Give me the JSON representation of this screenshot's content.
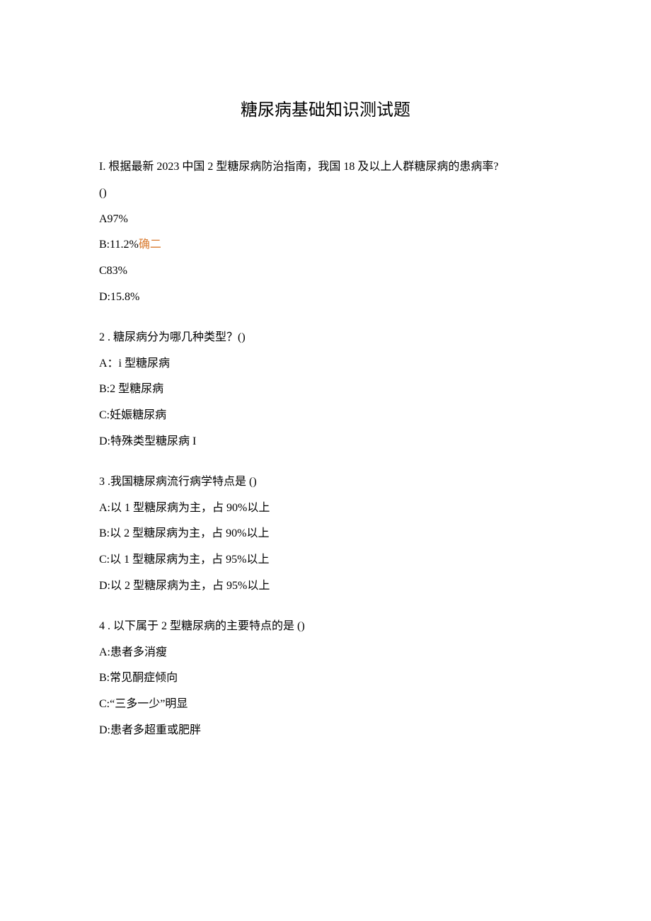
{
  "title": "糖尿病基础知识测试题",
  "q1": {
    "stem_a": "I. 根据最新 2023 中国 2 型糖尿病防治指南，我国 18 及以上人群糖尿病的患病率?",
    "stem_b": "()",
    "a": "A97%",
    "b_pre": "B:11.2%",
    "b_mark": "确二",
    "c": "C83%",
    "d": "D:15.8%"
  },
  "q2": {
    "stem": "2  . 糖尿病分为哪几种类型？()",
    "a": "A：i 型糖尿病",
    "b": "B:2 型糖尿病",
    "c": "C:妊娠糖尿病",
    "d": "D:特殊类型糖尿病 I"
  },
  "q3": {
    "stem": "3  .我国糖尿病流行病学特点是 ()",
    "a": "A:以 1 型糖尿病为主，占 90%以上",
    "b": "B:以 2 型糖尿病为主，占 90%以上",
    "c": "C:以 1 型糖尿病为主，占 95%以上",
    "d": "D:以 2 型糖尿病为主，占 95%以上"
  },
  "q4": {
    "stem": "4  . 以下属于 2 型糖尿病的主要特点的是 ()",
    "a": "A:患者多消瘦",
    "b": "B:常见酮症倾向",
    "c": "C:“三多一少”明显",
    "d": "D:患者多超重或肥胖"
  }
}
